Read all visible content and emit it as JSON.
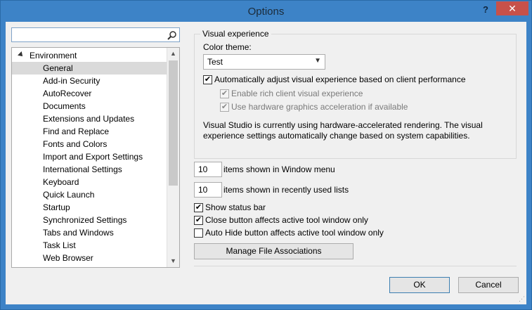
{
  "window": {
    "title": "Options",
    "help": "?",
    "close": "✕"
  },
  "search": {
    "placeholder": ""
  },
  "tree": {
    "parent": "Environment",
    "items": [
      {
        "label": "General"
      },
      {
        "label": "Add-in Security"
      },
      {
        "label": "AutoRecover"
      },
      {
        "label": "Documents"
      },
      {
        "label": "Extensions and Updates"
      },
      {
        "label": "Find and Replace"
      },
      {
        "label": "Fonts and Colors"
      },
      {
        "label": "Import and Export Settings"
      },
      {
        "label": "International Settings"
      },
      {
        "label": "Keyboard"
      },
      {
        "label": "Quick Launch"
      },
      {
        "label": "Startup"
      },
      {
        "label": "Synchronized Settings"
      },
      {
        "label": "Tabs and Windows"
      },
      {
        "label": "Task List"
      },
      {
        "label": "Web Browser"
      }
    ],
    "selected_index": 0
  },
  "visual": {
    "group_label": "Visual experience",
    "theme_label": "Color theme:",
    "theme_value": "Test",
    "auto_adjust_label": "Automatically adjust visual experience based on client performance",
    "auto_adjust_checked": true,
    "rich_label": "Enable rich client visual experience",
    "rich_checked": true,
    "hw_label": "Use hardware graphics acceleration if available",
    "hw_checked": true,
    "info_line1": "Visual Studio is currently using hardware-accelerated rendering. The visual",
    "info_line2": "experience settings automatically change based on system capabilities."
  },
  "window_menu": {
    "value": "10",
    "label": "items shown in Window menu"
  },
  "recent_lists": {
    "value": "10",
    "label": "items shown in recently used lists"
  },
  "status_bar": {
    "label": "Show status bar",
    "checked": true
  },
  "close_button": {
    "label": "Close button affects active tool window only",
    "checked": true
  },
  "auto_hide": {
    "label": "Auto Hide button affects active tool window only",
    "checked": false
  },
  "manage_button": "Manage File Associations",
  "ok_button": "OK",
  "cancel_button": "Cancel",
  "colors": {
    "title_bar": "#3d83c7",
    "close": "#c7514a",
    "selection": "#dadada"
  }
}
